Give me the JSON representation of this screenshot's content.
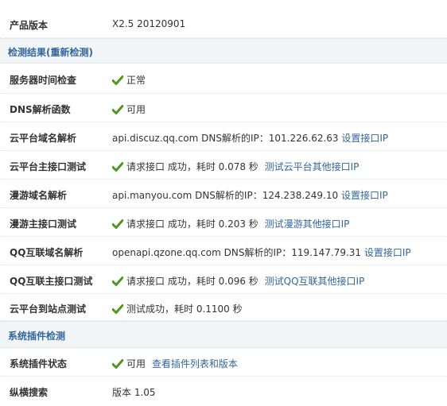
{
  "rows": {
    "version": {
      "label": "产品版本",
      "value": "X2.5 20120901"
    },
    "section_check": {
      "title": "检测结果(重新检测)"
    },
    "server_time": {
      "label": "服务器时间检查",
      "text": "正常"
    },
    "dns_func": {
      "label": "DNS解析函数",
      "text": "可用"
    },
    "cloud_dns": {
      "label": "云平台域名解析",
      "host": "api.discuz.qq.com",
      "text": "DNS解析的IP：101.226.62.63",
      "link": "设置接口IP"
    },
    "cloud_api": {
      "label": "云平台主接口测试",
      "text": "请求接口 成功，耗时 0.078 秒",
      "link": "测试云平台其他接口IP"
    },
    "manyou_dns": {
      "label": "漫游域名解析",
      "host": "api.manyou.com",
      "text": "DNS解析的IP：124.238.249.10",
      "link": "设置接口IP"
    },
    "manyou_api": {
      "label": "漫游主接口测试",
      "text": "请求接口 成功，耗时 0.203 秒",
      "link": "测试漫游其他接口IP"
    },
    "qq_dns": {
      "label": "QQ互联域名解析",
      "host": "openapi.qzone.qq.com",
      "text": "DNS解析的IP：119.147.79.31",
      "link": "设置接口IP"
    },
    "qq_api": {
      "label": "QQ互联主接口测试",
      "text": "请求接口 成功，耗时 0.096 秒",
      "link": "测试QQ互联其他接口IP"
    },
    "site_test": {
      "label": "云平台到站点测试",
      "text": "测试成功，耗时 0.1100 秒"
    },
    "section_plugin": {
      "title": "系统插件检测"
    },
    "plugin_status": {
      "label": "系统插件状态",
      "text": "可用",
      "link": "查看插件列表和版本"
    },
    "search": {
      "label": "纵横搜索",
      "value": "版本 1.05"
    }
  },
  "icon": "check-icon",
  "colors": {
    "check": "#4a9a1e",
    "link": "#336699",
    "section_bg": "#f1f5f8"
  }
}
